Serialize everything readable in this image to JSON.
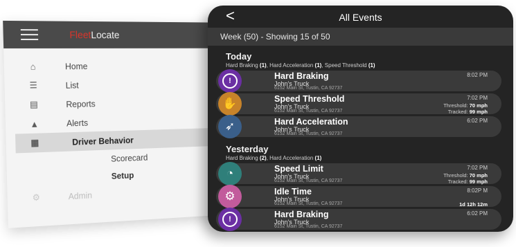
{
  "sidebar_app": {
    "brand_part1": "Fleet",
    "brand_part2": "Locate",
    "items": [
      {
        "label": "Home",
        "icon": "home-icon",
        "glyph": "⌂"
      },
      {
        "label": "List",
        "icon": "list-icon",
        "glyph": "☰"
      },
      {
        "label": "Reports",
        "icon": "reports-icon",
        "glyph": "▤"
      },
      {
        "label": "Alerts",
        "icon": "alert-icon",
        "glyph": "▲"
      },
      {
        "label": "Driver Behavior",
        "icon": "clipboard-icon",
        "glyph": "▦"
      }
    ],
    "sub_items": [
      "Scorecard",
      "Setup"
    ],
    "admin_label": "Admin",
    "admin_icon_glyph": "⚙"
  },
  "phone": {
    "title": "All Events",
    "back_glyph": "<",
    "week_summary": "Week (50) - Showing 15 of 50",
    "sections": [
      {
        "title": "Today",
        "summary": [
          {
            "name": "Hard Braking",
            "count": "(1)"
          },
          {
            "name": "Hard Acceleration",
            "count": "(1)"
          },
          {
            "name": "Speed Threshold",
            "count": "(1)"
          }
        ],
        "events": [
          {
            "title": "Hard Braking",
            "vehicle": "John's Truck",
            "address": "6152 Main St, Tustin, CA 92737",
            "time": "8:02 PM",
            "color": "#6b2fa3",
            "icon": "brake-warning-icon",
            "glyph": "!"
          },
          {
            "title": "Speed Threshold",
            "vehicle": "John's Truck",
            "address": "6152 Main St, Tustin, CA 92737",
            "time": "7:02 PM",
            "threshold_label": "Threshold:",
            "threshold_value": "70 mph",
            "tracked_label": "Tracked:",
            "tracked_value": "99 mph",
            "color": "#c7832a",
            "icon": "hand-stop-icon",
            "glyph": "✋"
          },
          {
            "title": "Hard Acceleration",
            "vehicle": "John's Truck",
            "address": "6152 Main St, Tustin, CA 92737",
            "time": "6:02 PM",
            "color": "#3a5f8a",
            "icon": "pedal-icon",
            "glyph": "➶"
          }
        ]
      },
      {
        "title": "Yesterday",
        "summary": [
          {
            "name": "Hard Braking",
            "count": "(2)"
          },
          {
            "name": "Hard Acceleration",
            "count": "(1)"
          }
        ],
        "events": [
          {
            "title": "Speed Limit",
            "vehicle": "John's Truck",
            "address": "6152 Main St, Tustin, CA 92737",
            "time": "7:02 PM",
            "threshold_label": "Threshold:",
            "threshold_value": "70 mph",
            "tracked_label": "Tracked:",
            "tracked_value": "99 mph",
            "color": "#2f7f7a",
            "icon": "speedometer-icon",
            "glyph": "◔"
          },
          {
            "title": "Idle Time",
            "vehicle": "John's Truck",
            "address": "6152 Main St, Tustin, CA 92737",
            "time": "8:02P M",
            "duration": "1d 12h 12m",
            "color": "#c25b9c",
            "icon": "engine-icon",
            "glyph": "⚙"
          },
          {
            "title": "Hard Braking",
            "vehicle": "John's Truck",
            "address": "6152 Main St, Tustin, CA 92737",
            "time": "6:02 PM",
            "color": "#6b2fa3",
            "icon": "brake-warning-icon",
            "glyph": "!"
          }
        ]
      }
    ]
  }
}
